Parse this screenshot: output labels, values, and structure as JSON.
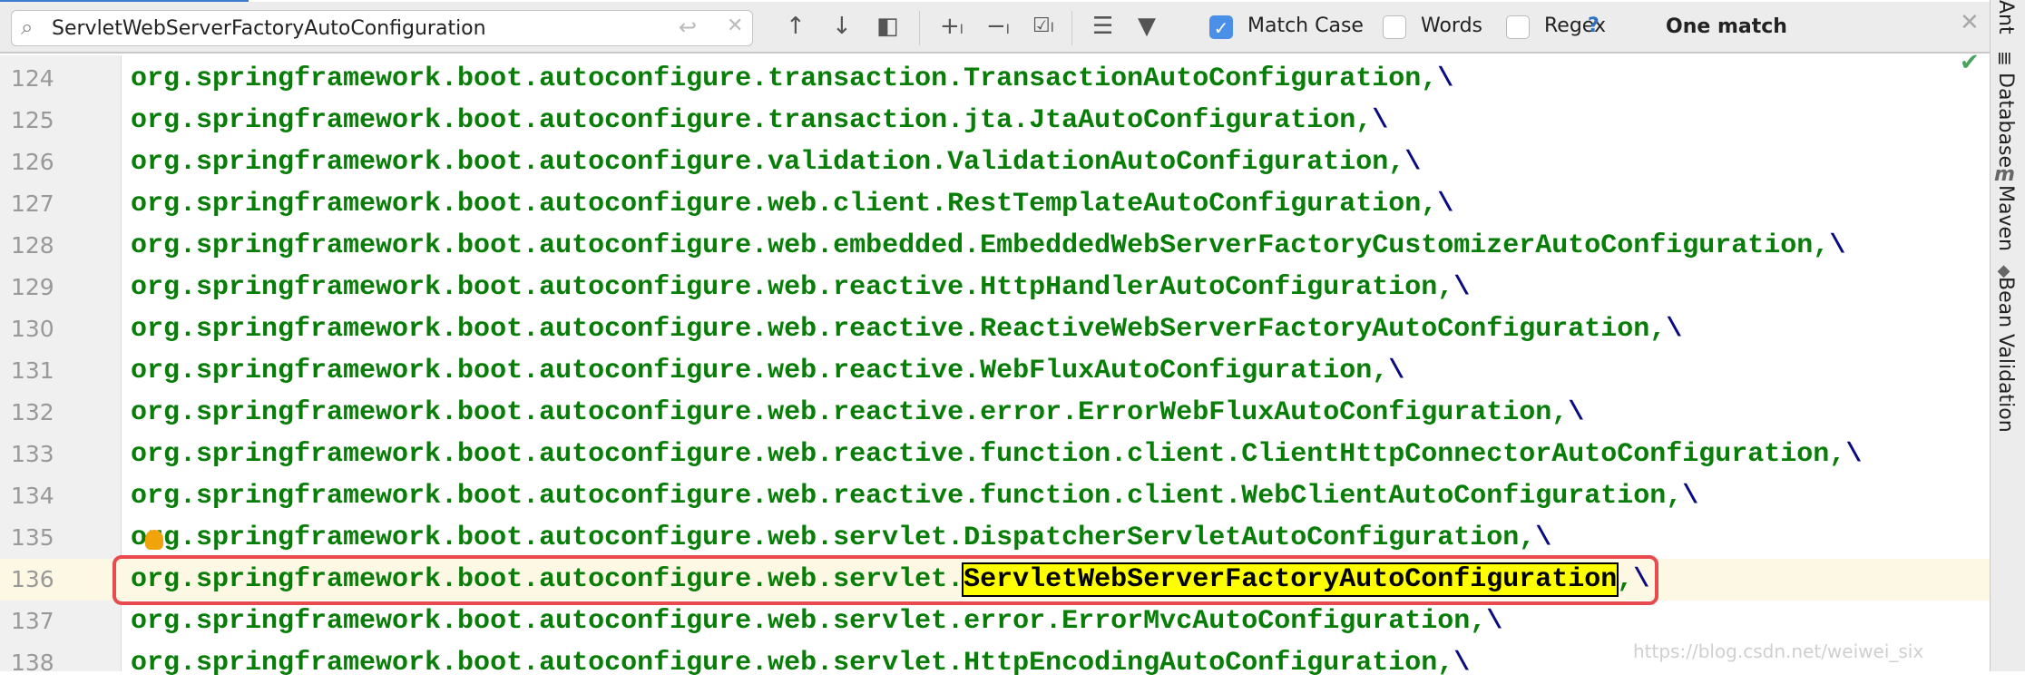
{
  "search": {
    "query": "ServletWebServerFactoryAutoConfiguration",
    "icon": "search-icon"
  },
  "toolbar": {
    "match_case": {
      "label": "Match Case",
      "checked": true
    },
    "words": {
      "label": "Words",
      "checked": false
    },
    "regex": {
      "label": "Regex",
      "checked": false
    },
    "help": "?",
    "result": "One match"
  },
  "editor": {
    "lines": [
      {
        "n": "124",
        "text": "org.springframework.boot.autoconfigure.transaction.TransactionAutoConfiguration,"
      },
      {
        "n": "125",
        "text": "org.springframework.boot.autoconfigure.transaction.jta.JtaAutoConfiguration,"
      },
      {
        "n": "126",
        "text": "org.springframework.boot.autoconfigure.validation.ValidationAutoConfiguration,"
      },
      {
        "n": "127",
        "text": "org.springframework.boot.autoconfigure.web.client.RestTemplateAutoConfiguration,"
      },
      {
        "n": "128",
        "text": "org.springframework.boot.autoconfigure.web.embedded.EmbeddedWebServerFactoryCustomizerAutoConfiguration,"
      },
      {
        "n": "129",
        "text": "org.springframework.boot.autoconfigure.web.reactive.HttpHandlerAutoConfiguration,"
      },
      {
        "n": "130",
        "text": "org.springframework.boot.autoconfigure.web.reactive.ReactiveWebServerFactoryAutoConfiguration,"
      },
      {
        "n": "131",
        "text": "org.springframework.boot.autoconfigure.web.reactive.WebFluxAutoConfiguration,"
      },
      {
        "n": "132",
        "text": "org.springframework.boot.autoconfigure.web.reactive.error.ErrorWebFluxAutoConfiguration,"
      },
      {
        "n": "133",
        "text": "org.springframework.boot.autoconfigure.web.reactive.function.client.ClientHttpConnectorAutoConfiguration,"
      },
      {
        "n": "134",
        "text": "org.springframework.boot.autoconfigure.web.reactive.function.client.WebClientAutoConfiguration,"
      },
      {
        "n": "135",
        "text": "org.springframework.boot.autoconfigure.web.servlet.DispatcherServletAutoConfiguration,"
      },
      {
        "n": "136",
        "prefix": "org.springframework.boot.autoconfigure.web.servlet.",
        "match": "ServletWebServerFactoryAutoConfiguration",
        "suffix": ","
      },
      {
        "n": "137",
        "text": "org.springframework.boot.autoconfigure.web.servlet.error.ErrorMvcAutoConfiguration,"
      },
      {
        "n": "138",
        "text": "org.springframework.boot.autoconfigure.web.servlet.HttpEncodingAutoConfiguration,"
      }
    ],
    "continuation": "\\"
  },
  "sidebar": {
    "items": [
      {
        "label": "Ant"
      },
      {
        "label": "Database",
        "icon": "database-icon"
      },
      {
        "label": "Maven",
        "icon": "maven-icon"
      },
      {
        "label": "Bean Validation",
        "icon": "bean-validation-icon"
      }
    ]
  },
  "watermark": "https://blog.csdn.net/weiwei_six",
  "colors": {
    "code": "#087d08",
    "backslash": "#0a0a80",
    "match": "#ffff00",
    "current_line": "#fdf8e4",
    "annotation_box": "#e84a4d"
  }
}
